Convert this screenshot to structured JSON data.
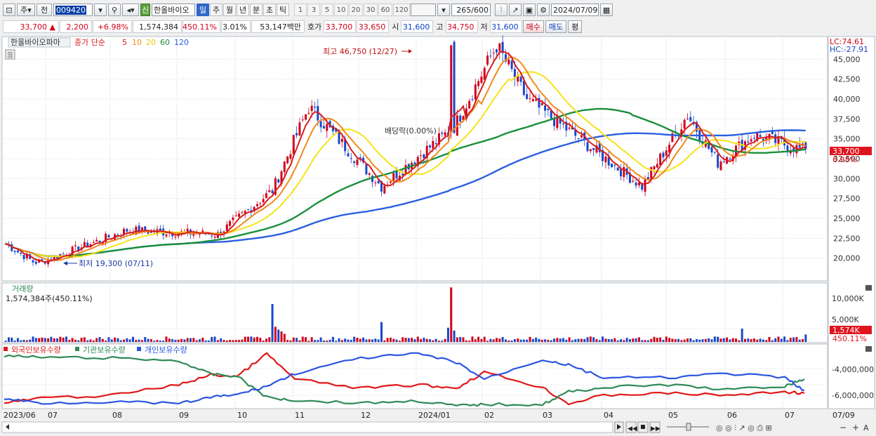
{
  "toolbar": {
    "market_label": "주",
    "prev_label": "전",
    "code": "009420",
    "new_badge": "신",
    "stock_name": "한올바이오",
    "period_tabs": [
      "일",
      "주",
      "월",
      "년",
      "분",
      "초",
      "틱"
    ],
    "active_tab": "일",
    "interval_buttons": [
      "1",
      "3",
      "5",
      "10",
      "20",
      "30",
      "60",
      "120"
    ],
    "count_value": "265",
    "count_max": "/600",
    "date_value": "2024/07/09"
  },
  "quote": {
    "price": "33,700",
    "change_arrow": "▲",
    "change": "2,200",
    "change_pct": "+6.98%",
    "volume": "1,574,384",
    "volume_ratio": "450.11%",
    "turnover": "3.01%",
    "trade_value": "53,147백만",
    "ask_label": "호가",
    "ask": "33,700",
    "bid": "33,650",
    "open_label": "시",
    "open": "31,600",
    "high_label": "고",
    "high": "34,750",
    "low_label": "저",
    "low": "31,600",
    "buy_button": "매수",
    "sell_button": "매도",
    "eval_button": "평"
  },
  "colors": {
    "ma5": "#d61e1e",
    "ma10": "#f08a1c",
    "ma20": "#f5e31a",
    "ma60": "#1a8f3a",
    "ma120": "#2b5fe0",
    "up": "#d0021b",
    "down": "#1a47c9",
    "foreign": "#e01818",
    "institution": "#2f8a57",
    "individual": "#2b55e0"
  },
  "chart_data": [
    {
      "type": "candlestick",
      "title": "한올바이오파마",
      "legend": {
        "label": "종가 단순",
        "periods": [
          "5",
          "10",
          "20",
          "60",
          "120"
        ]
      },
      "y_ticks": [
        "45,000",
        "42,500",
        "40,000",
        "37,500",
        "35,000",
        "32,500",
        "30,000",
        "27,500",
        "25,000",
        "22,500",
        "20,000"
      ],
      "ylim": [
        17500,
        47500
      ],
      "x_tick_labels": [
        "2023/06",
        "07",
        "08",
        "09",
        "10",
        "11",
        "12",
        "2024/01",
        "02",
        "03",
        "04",
        "05",
        "06",
        "07",
        "07/09"
      ],
      "lc": "LC:74.61",
      "hc": "HC:-27.91",
      "last_price_label": "33,700",
      "last_change_label": "6.98%",
      "annotations": {
        "high": "최고 46,750 (12/27)",
        "low": "최저 19,300 (07/11)",
        "dividend": "배당락(0.00%)"
      },
      "key_points": [
        {
          "date": "2023/06",
          "close": 21800
        },
        {
          "date": "07/11",
          "close": 19300
        },
        {
          "date": "08",
          "close": 23500
        },
        {
          "date": "09",
          "close": 23000
        },
        {
          "date": "09 end",
          "close": 28500
        },
        {
          "date": "10",
          "close": 39000
        },
        {
          "date": "11",
          "close": 29000
        },
        {
          "date": "12",
          "close": 36500
        },
        {
          "date": "12/27",
          "close": 46750
        },
        {
          "date": "2024/01",
          "close": 40000
        },
        {
          "date": "02",
          "close": 29000
        },
        {
          "date": "03",
          "close": 38000
        },
        {
          "date": "04",
          "close": 32000
        },
        {
          "date": "05",
          "close": 35500
        },
        {
          "date": "06",
          "close": 33500
        },
        {
          "date": "07/09",
          "close": 33700
        }
      ]
    },
    {
      "type": "bar",
      "title": "거래량",
      "subtitle": "1,574,384주(450.11%)",
      "y_ticks": [
        "10,000K",
        "5,000K"
      ],
      "last_label": "1,574K",
      "last_pct": "450.11%",
      "peaks": [
        {
          "date": "10",
          "value": 8000
        },
        {
          "date": "12/27",
          "value": 11500
        },
        {
          "date": "12",
          "value": 4200
        },
        {
          "date": "06",
          "value": 2800
        },
        {
          "date": "07/09",
          "value": 1574
        }
      ]
    },
    {
      "type": "line",
      "legend": [
        "외국인보유수량",
        "기관보유수량",
        "개인보유수량"
      ],
      "y_ticks": [
        "-4,000,000",
        "-6,000,000"
      ]
    }
  ],
  "bottom": {
    "controls": [
      "▶",
      "◀◀",
      "■",
      "▶▶",
      "▲",
      "-",
      "+",
      "A"
    ]
  }
}
